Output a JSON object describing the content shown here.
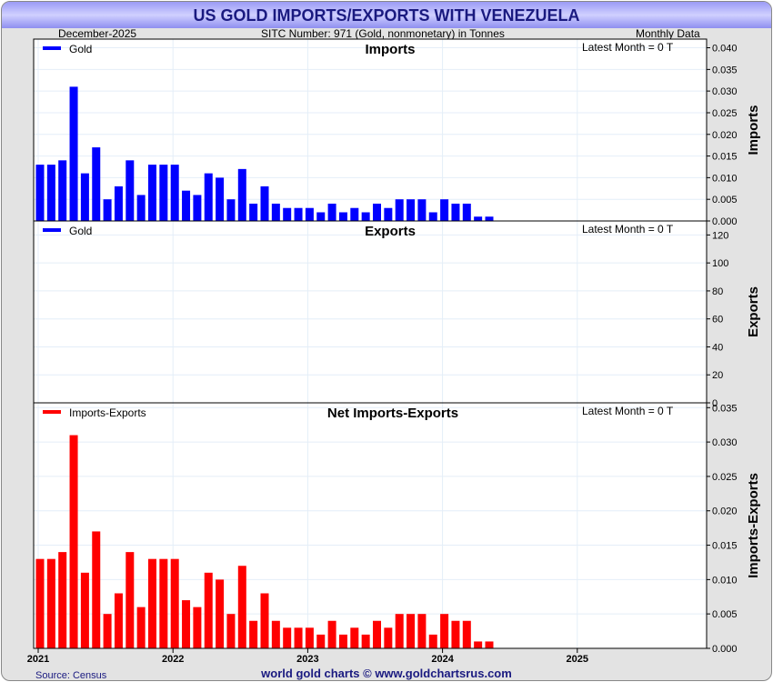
{
  "header": {
    "title": "US GOLD IMPORTS/EXPORTS WITH VENEZUELA",
    "date": "December-2025",
    "subtitle": "SITC Number: 971 (Gold, nonmonetary) in Tonnes",
    "frequency": "Monthly Data"
  },
  "footer": {
    "source": "Source: Census",
    "credit": "world gold charts © www.goldchartsrus.com"
  },
  "colors": {
    "imports": "#0000ff",
    "exports": "#0000ff",
    "net": "#ff0000"
  },
  "chart_data": [
    {
      "type": "bar",
      "title": "Imports",
      "legend": "Gold",
      "ylabel": "Imports",
      "latest": "Latest Month = 0 T",
      "ylim": [
        0,
        0.042
      ],
      "yticks": [
        "0.000",
        "0.005",
        "0.010",
        "0.015",
        "0.020",
        "0.025",
        "0.030",
        "0.035",
        "0.040"
      ],
      "start": "2021-01",
      "values": [
        0.013,
        0.013,
        0.014,
        0.031,
        0.011,
        0.017,
        0.005,
        0.008,
        0.014,
        0.006,
        0.013,
        0.013,
        0.013,
        0.007,
        0.006,
        0.011,
        0.01,
        0.005,
        0.012,
        0.004,
        0.008,
        0.004,
        0.003,
        0.003,
        0.003,
        0.002,
        0.004,
        0.002,
        0.003,
        0.002,
        0.004,
        0.003,
        0.005,
        0.005,
        0.005,
        0.002,
        0.005,
        0.004,
        0.004,
        0.001,
        0.001
      ]
    },
    {
      "type": "bar",
      "title": "Exports",
      "legend": "Gold",
      "ylabel": "Exports",
      "latest": "Latest Month = 0 T",
      "ylim": [
        0,
        130
      ],
      "yticks": [
        "0",
        "20",
        "40",
        "60",
        "80",
        "100",
        "120"
      ],
      "start": "2021-01",
      "values": []
    },
    {
      "type": "bar",
      "title": "Net Imports-Exports",
      "legend": "Imports-Exports",
      "ylabel": "Imports-Exports",
      "latest": "Latest Month = 0 T",
      "ylim": [
        0,
        0.0357
      ],
      "yticks": [
        "0.000",
        "0.005",
        "0.010",
        "0.015",
        "0.020",
        "0.025",
        "0.030",
        "0.035"
      ],
      "start": "2021-01",
      "values": [
        0.013,
        0.013,
        0.014,
        0.031,
        0.011,
        0.017,
        0.005,
        0.008,
        0.014,
        0.006,
        0.013,
        0.013,
        0.013,
        0.007,
        0.006,
        0.011,
        0.01,
        0.005,
        0.012,
        0.004,
        0.008,
        0.004,
        0.003,
        0.003,
        0.003,
        0.002,
        0.004,
        0.002,
        0.003,
        0.002,
        0.004,
        0.003,
        0.005,
        0.005,
        0.005,
        0.002,
        0.005,
        0.004,
        0.004,
        0.001,
        0.001
      ]
    }
  ],
  "xticks": [
    "2021",
    "2022",
    "2023",
    "2024",
    "2025"
  ]
}
